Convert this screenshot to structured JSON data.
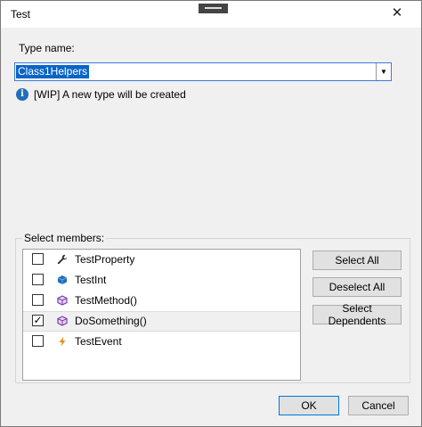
{
  "window": {
    "title": "Test"
  },
  "type_name": {
    "label": "Type name:",
    "value": "Class1Helpers"
  },
  "info": {
    "message": "[WIP] A new type will be created"
  },
  "members": {
    "label": "Select members:",
    "items": [
      {
        "name": "TestProperty",
        "checked": false,
        "icon": "wrench-icon",
        "color": "#333333"
      },
      {
        "name": "TestInt",
        "checked": false,
        "icon": "field-icon",
        "color": "#1f6fb8"
      },
      {
        "name": "TestMethod()",
        "checked": false,
        "icon": "method-cube-icon",
        "color": "#7b3fa8"
      },
      {
        "name": "DoSomething()",
        "checked": true,
        "icon": "method-cube-icon",
        "color": "#7b3fa8"
      },
      {
        "name": "TestEvent",
        "checked": false,
        "icon": "lightning-icon",
        "color": "#e8901a"
      }
    ]
  },
  "buttons": {
    "select_all": "Select All",
    "deselect_all": "Deselect All",
    "select_dependents": "Select Dependents",
    "ok": "OK",
    "cancel": "Cancel"
  },
  "colors": {
    "accent": "#0078d7",
    "selection": "#0a64c8",
    "info": "#1f6fb8"
  }
}
